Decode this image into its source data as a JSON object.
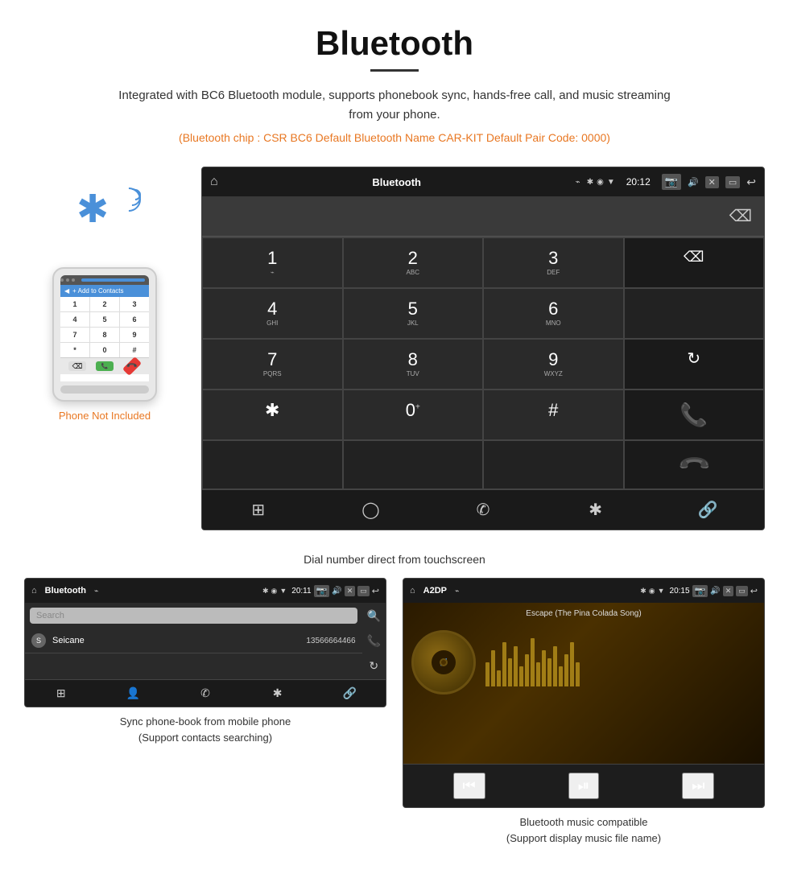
{
  "page": {
    "title": "Bluetooth",
    "description": "Integrated with BC6 Bluetooth module, supports phonebook sync, hands-free call, and music streaming from your phone.",
    "specs_line": "(Bluetooth chip : CSR BC6    Default Bluetooth Name CAR-KIT    Default Pair Code: 0000)",
    "phone_not_included": "Phone Not Included",
    "dial_caption": "Dial number direct from touchscreen",
    "bottom_left_caption": "Sync phone-book from mobile phone\n(Support contacts searching)",
    "bottom_right_caption": "Bluetooth music compatible\n(Support display music file name)"
  },
  "car_screen": {
    "status": {
      "home_icon": "⌂",
      "title": "Bluetooth",
      "usb_icon": "⌁",
      "bt_icon": "✱",
      "location_icon": "◉",
      "wifi_icon": "▼",
      "time": "20:12",
      "camera_icon": "📷",
      "volume_icon": "🔊",
      "close_icon": "✕",
      "screen_icon": "▭",
      "back_icon": "↩"
    },
    "keys": [
      {
        "main": "1",
        "sub": "⌁",
        "type": "digit"
      },
      {
        "main": "2",
        "sub": "ABC",
        "type": "digit"
      },
      {
        "main": "3",
        "sub": "DEF",
        "type": "digit"
      },
      {
        "main": "",
        "sub": "",
        "type": "empty"
      },
      {
        "main": "4",
        "sub": "GHI",
        "type": "digit"
      },
      {
        "main": "5",
        "sub": "JKL",
        "type": "digit"
      },
      {
        "main": "6",
        "sub": "MNO",
        "type": "digit"
      },
      {
        "main": "",
        "sub": "",
        "type": "empty"
      },
      {
        "main": "7",
        "sub": "PQRS",
        "type": "digit"
      },
      {
        "main": "8",
        "sub": "TUV",
        "type": "digit"
      },
      {
        "main": "9",
        "sub": "WXYZ",
        "type": "digit"
      },
      {
        "main": "reload",
        "sub": "",
        "type": "action"
      },
      {
        "main": "*",
        "sub": "",
        "type": "symbol"
      },
      {
        "main": "0",
        "sub": "+",
        "type": "digit"
      },
      {
        "main": "#",
        "sub": "",
        "type": "symbol"
      },
      {
        "main": "call_green",
        "sub": "",
        "type": "call"
      },
      {
        "main": "call_red",
        "sub": "",
        "type": "hangup"
      }
    ],
    "nav_icons": [
      "⊞",
      "👤",
      "📞",
      "✱",
      "🔗"
    ],
    "backspace_icon": "⌫"
  },
  "phonebook_screen": {
    "status": {
      "home_icon": "⌂",
      "title": "Bluetooth",
      "usb_icon": "⌁",
      "bt_icon": "✱",
      "location_icon": "◉",
      "wifi_icon": "▼",
      "time": "20:11",
      "camera_icon": "📷",
      "volume_icon": "🔊",
      "close_icon": "✕",
      "screen_icon": "▭",
      "back_icon": "↩"
    },
    "search_placeholder": "Search",
    "contacts": [
      {
        "initial": "S",
        "name": "Seicane",
        "number": "13566664466"
      }
    ],
    "right_icons": [
      "🔍",
      "📞",
      "↻"
    ],
    "nav_icons": [
      "⊞",
      "👤",
      "📞",
      "✱",
      "🔗"
    ]
  },
  "music_screen": {
    "status": {
      "home_icon": "⌂",
      "title": "A2DP",
      "usb_icon": "⌁",
      "bt_icon": "✱",
      "location_icon": "◉",
      "wifi_icon": "▼",
      "time": "20:15",
      "camera_icon": "📷",
      "volume_icon": "🔊",
      "close_icon": "✕",
      "screen_icon": "▭",
      "back_icon": "↩"
    },
    "track_name": "Escape (The Pina Colada Song)",
    "bt_music_icon": "✱",
    "controls": {
      "prev": "⏮",
      "play_pause": "⏯",
      "next": "⏭"
    },
    "viz_bars": [
      30,
      45,
      20,
      55,
      35,
      50,
      25,
      40,
      60,
      30,
      45,
      35,
      50,
      25,
      40,
      55,
      30
    ]
  },
  "phone_mockup": {
    "keys": [
      "1",
      "2",
      "3",
      "4",
      "5",
      "6",
      "7",
      "8",
      "9",
      "*",
      "0",
      "#"
    ],
    "add_to_contacts": "+ Add to Contacts"
  }
}
